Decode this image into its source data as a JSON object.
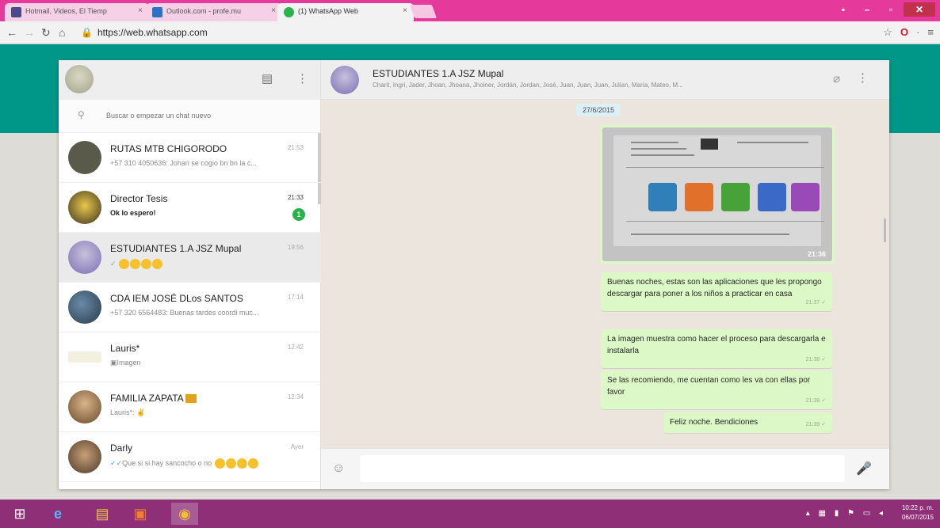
{
  "browser": {
    "tabs": [
      {
        "label": "Hotmail, Videos, El Tiemp",
        "favicon_color": "#4a4a8a"
      },
      {
        "label": "Outlook.com - profe.mu",
        "favicon_color": "#2a72c4"
      },
      {
        "label": "(1) WhatsApp Web",
        "favicon_color": "#2bb24c"
      }
    ],
    "url": "https://web.whatsapp.com",
    "tab_close": "×"
  },
  "left_pane": {
    "search_placeholder": "Buscar o empezar un chat nuevo",
    "chats": [
      {
        "name": "RUTAS MTB CHIGORODO",
        "time": "21:53",
        "preview": "+57 310 4050636: Johan se cogio bn bn la c...",
        "avatar_color": "#5a5a4a"
      },
      {
        "name": "Director Tesis",
        "time": "21:33",
        "preview": "Ok lo espero!",
        "unread": "1",
        "avatar_color": "#caa42a"
      },
      {
        "name": "ESTUDIANTES 1.A JSZ Mupal",
        "time": "19:56",
        "preview": "✓",
        "avatar_color": "#7b70b4"
      },
      {
        "name": "CDA IEM JOSÉ DLos SANTOS",
        "time": "17:14",
        "preview": "+57 320 6564483: Buenas tardes coordi muc...",
        "avatar_color": "#3a5a7a"
      },
      {
        "name": "Lauris*",
        "time": "12:42",
        "preview": "Imagen",
        "avatar_color": "#f4f0e0"
      },
      {
        "name": "FAMILIA ZAPATA",
        "time": "12:34",
        "preview": "Lauris*:",
        "avatar_color": "#a0643c"
      },
      {
        "name": "Darly",
        "time": "Ayer",
        "preview": "Que si si hay sancocho o no",
        "avatar_color": "#7a6040"
      }
    ]
  },
  "chat": {
    "title": "ESTUDIANTES 1.A JSZ Mupal",
    "members": "Charit, Ingri, Jader, Jhoan, Jhoana, Jhoiner, Jordán, Jordan, José, Juan, Juan, Juan, Julian, María, Mateo, M...",
    "date_chip": "27/6/2015",
    "image_time": "21:36",
    "messages": [
      {
        "text": "Buenas noches, estas son las aplicaciones que les propongo descargar para poner a los niños a practicar en casa",
        "time": "21:37 ✓"
      },
      {
        "text": "La imagen muestra como hacer el proceso para descargarla e instalarla",
        "time": "21:38 ✓"
      },
      {
        "text": "Se las recomiendo, me cuentan como les va con ellas por favor",
        "time": "21:38 ✓"
      },
      {
        "text": "Feliz noche. Bendiciones",
        "time": "21:39 ✓"
      }
    ],
    "composer_value": ""
  },
  "taskbar": {
    "clock_time": "10:22 p. m.",
    "clock_date": "06/07/2015"
  },
  "colors": {
    "brand_green": "#009688",
    "bubble_green": "#dcf8c6",
    "chat_bg": "#ece5dd",
    "taskbar": "#8f2f78",
    "tabstrip": "#e5399c"
  },
  "icons": {
    "search": "search-icon",
    "new_chat": "new-chat-icon",
    "menu": "menu-icon",
    "attach": "paperclip-icon",
    "emoji": "emoji-icon",
    "mic": "microphone-icon"
  }
}
